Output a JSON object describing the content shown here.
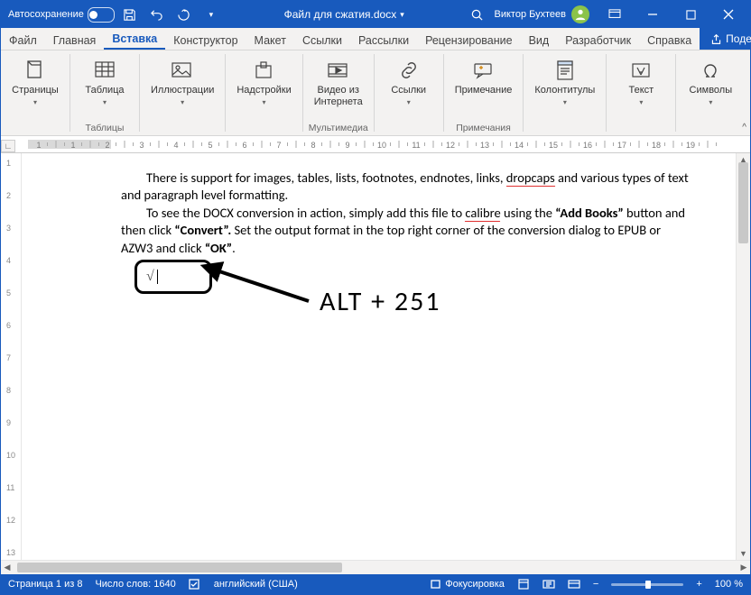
{
  "titlebar": {
    "autosave": "Автосохранение",
    "filename": "Файл для сжатия.docx",
    "user": "Виктор Бухтеев"
  },
  "tabs": {
    "file": "Файл",
    "home": "Главная",
    "insert": "Вставка",
    "design": "Конструктор",
    "layout": "Макет",
    "references": "Ссылки",
    "mailings": "Рассылки",
    "review": "Рецензирование",
    "view": "Вид",
    "developer": "Разработчик",
    "help": "Справка",
    "share": "Поделиться"
  },
  "ribbon": {
    "pages": "Страницы",
    "table": "Таблица",
    "illustrations": "Иллюстрации",
    "addins": "Надстройки",
    "onlinevideo_1": "Видео из",
    "onlinevideo_2": "Интернета",
    "links": "Ссылки",
    "comment": "Примечание",
    "headerfooter": "Колонтитулы",
    "text": "Текст",
    "symbols": "Символы",
    "grp_tables": "Таблицы",
    "grp_media": "Мультимедиа",
    "grp_comments": "Примечания"
  },
  "ruler": {
    "numbers": [
      "1",
      "1",
      "2",
      "3",
      "4",
      "5",
      "6",
      "7",
      "8",
      "9",
      "10",
      "11",
      "12",
      "13",
      "14",
      "15",
      "16",
      "17",
      "18",
      "19"
    ]
  },
  "vruler": {
    "numbers": [
      "1",
      "2",
      "3",
      "4",
      "5",
      "6",
      "7",
      "8",
      "9",
      "10",
      "11",
      "12",
      "13"
    ]
  },
  "doc": {
    "p1_a": "There is support for images, tables, lists, footnotes, endnotes, links, ",
    "p1_drop": "dropcaps",
    "p1_b": " and various types of text and paragraph level formatting.",
    "p2_a": "To see the DOCX conversion in action, simply add this file to ",
    "p2_cal": "calibre",
    "p2_b": " using the ",
    "p2_add": "“Add Books”",
    "p2_c": " button and then click ",
    "p2_conv": "“Convert”.",
    "p2_d": "  Set the output format in the top right corner of the conversion dialog to EPUB or AZW3 and click ",
    "p2_ok": "“OK”",
    "p2_e": ".",
    "sqrt": "√",
    "alt": "ALT + 251"
  },
  "status": {
    "page": "Страница 1 из 8",
    "words": "Число слов: 1640",
    "lang": "английский (США)",
    "focus": "Фокусировка",
    "zoom_minus": "−",
    "zoom_plus": "+",
    "zoom": "100 %"
  }
}
